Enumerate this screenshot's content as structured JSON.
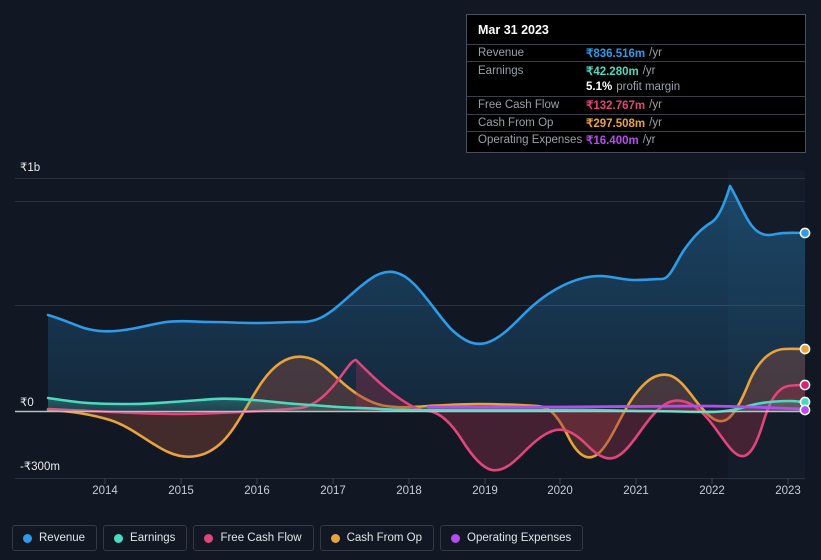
{
  "tooltip": {
    "title": "Mar 31 2023",
    "rows": [
      {
        "key": "Revenue",
        "value": "₹836.516m",
        "unit": "/yr",
        "color": "#2d9ce8"
      },
      {
        "key": "Earnings",
        "value": "₹42.280m",
        "unit": "/yr",
        "color": "#4dd8c0"
      },
      {
        "key": "",
        "value": "5.1%",
        "unit": "profit margin",
        "color": "#ffffff"
      },
      {
        "key": "Free Cash Flow",
        "value": "₹132.767m",
        "unit": "/yr",
        "color": "#e0457b"
      },
      {
        "key": "Cash From Op",
        "value": "₹297.508m",
        "unit": "/yr",
        "color": "#e8a33d"
      },
      {
        "key": "Operating Expenses",
        "value": "₹16.400m",
        "unit": "/yr",
        "color": "#b44cf0"
      }
    ]
  },
  "legend": {
    "items": [
      {
        "label": "Revenue",
        "color": "#2d9ce8"
      },
      {
        "label": "Earnings",
        "color": "#4dd8c0"
      },
      {
        "label": "Free Cash Flow",
        "color": "#e0457b"
      },
      {
        "label": "Cash From Op",
        "color": "#e8a33d"
      },
      {
        "label": "Operating Expenses",
        "color": "#b44cf0"
      }
    ]
  },
  "chart_data": {
    "type": "area",
    "title": "",
    "xlabel": "",
    "ylabel": "",
    "currency": "₹",
    "grid": true,
    "legend_position": "bottom",
    "y_axis": {
      "ticks": [
        {
          "label": "₹1b",
          "value": 1000
        },
        {
          "label": "₹0",
          "value": 0
        },
        {
          "label": "-₹300m",
          "value": -300
        }
      ],
      "ylim": [
        -300,
        1000
      ],
      "unit": "m"
    },
    "x_axis": {
      "tick_labels": [
        "2014",
        "2015",
        "2016",
        "2017",
        "2018",
        "2019",
        "2020",
        "2021",
        "2022",
        "2023"
      ],
      "xlim": [
        "2013.3",
        "2023.4"
      ]
    },
    "series": [
      {
        "name": "Revenue",
        "color": "#2d9ce8",
        "x": [
          2013.3,
          2013.7,
          2014,
          2014.5,
          2015,
          2015.5,
          2016,
          2016.5,
          2017,
          2017.4,
          2017.8,
          2018.2,
          2018.6,
          2019,
          2019.4,
          2019.8,
          2020.2,
          2020.6,
          2021,
          2021.4,
          2021.7,
          2022,
          2022.3,
          2022.7,
          2023,
          2023.4
        ],
        "values": [
          410,
          385,
          370,
          348,
          360,
          380,
          372,
          375,
          372,
          430,
          500,
          530,
          500,
          420,
          395,
          440,
          520,
          560,
          575,
          640,
          700,
          815,
          965,
          760,
          800,
          836.516
        ]
      },
      {
        "name": "Earnings",
        "color": "#4dd8c0",
        "x": [
          2013.3,
          2014,
          2015,
          2016,
          2017,
          2018,
          2019,
          2020,
          2021,
          2022,
          2022.7,
          2023,
          2023.4
        ],
        "values": [
          52,
          40,
          32,
          28,
          40,
          18,
          10,
          2,
          5,
          -2,
          10,
          35,
          42.28
        ]
      },
      {
        "name": "Free Cash Flow",
        "color": "#e0457b",
        "x": [
          2013.3,
          2014,
          2015,
          2016,
          2017,
          2017.6,
          2018,
          2018.5,
          2019,
          2019.5,
          2020,
          2020.5,
          2021,
          2021.5,
          2022,
          2022.4,
          2022.8,
          2023,
          2023.4
        ],
        "values": [
          5,
          0,
          -5,
          -10,
          0,
          228,
          95,
          -60,
          -230,
          -160,
          -150,
          -60,
          95,
          0,
          -80,
          -215,
          30,
          130,
          132.767
        ]
      },
      {
        "name": "Cash From Op",
        "color": "#e8a33d",
        "x": [
          2013.3,
          2014,
          2015,
          2016,
          2017,
          2017.5,
          2018,
          2018.5,
          2019,
          2019.5,
          2020,
          2020.5,
          2021,
          2021.5,
          2022,
          2022.3,
          2022.7,
          2023,
          2023.4
        ],
        "values": [
          5,
          0,
          -10,
          -175,
          10,
          230,
          100,
          10,
          15,
          18,
          10,
          -175,
          60,
          105,
          -10,
          -30,
          240,
          295,
          297.508
        ]
      },
      {
        "name": "Operating Expenses",
        "color": "#b44cf0",
        "x": [
          2018.1,
          2019,
          2020,
          2021,
          2022,
          2023,
          2023.4
        ],
        "values": [
          14,
          14,
          14,
          14,
          14,
          16,
          16.4
        ]
      }
    ]
  }
}
